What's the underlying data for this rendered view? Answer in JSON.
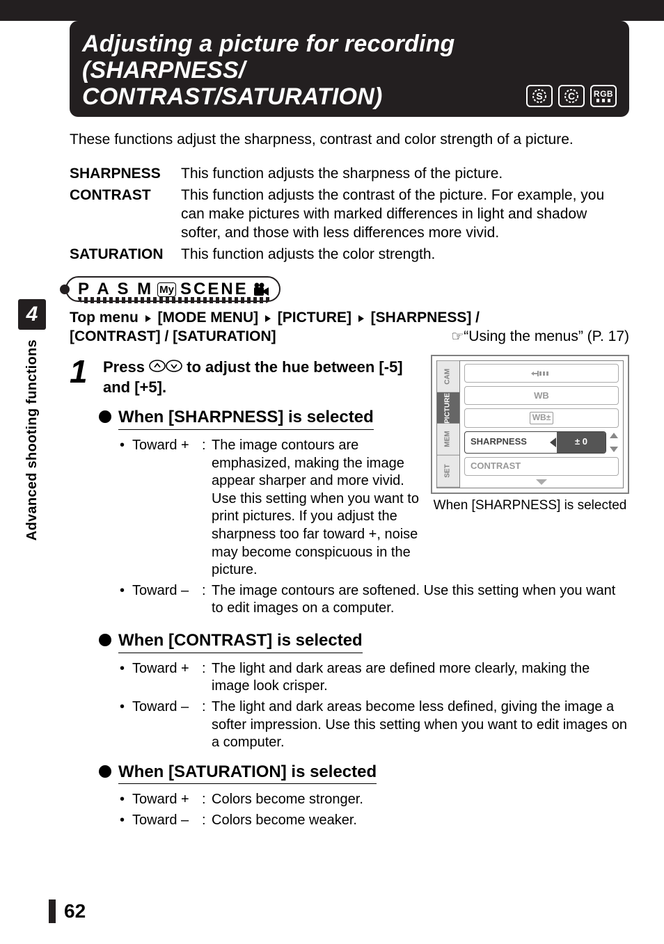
{
  "header": {
    "title_line1": "Adjusting a picture for recording (SHARPNESS/",
    "title_line2": "CONTRAST/SATURATION)",
    "icons": {
      "s": "S",
      "c": "C",
      "rgb": "RGB"
    }
  },
  "intro": "These functions adjust the sharpness, contrast and color strength of a picture.",
  "definitions": {
    "sharpness": {
      "term": "SHARPNESS",
      "desc": "This function adjusts the sharpness of the picture."
    },
    "contrast": {
      "term": "CONTRAST",
      "desc": "This function adjusts the contrast of the picture. For example, you can make pictures with marked differences in light and shadow softer, and those with less differences more vivid."
    },
    "saturation": {
      "term": "SATURATION",
      "desc": "This function adjusts the color strength."
    }
  },
  "mode_badge": {
    "modes": "P A S M",
    "my": "My",
    "scene": "SCENE"
  },
  "menu_path": {
    "line1_a": "Top menu ",
    "mode_menu": "[MODE MENU]",
    "picture": "[PICTURE]",
    "sharp": "[SHARPNESS] /",
    "line2_left": "[CONTRAST] / [SATURATION]",
    "ref_text": "“Using the menus” (P. 17)"
  },
  "step1": {
    "num": "1",
    "text_a": "Press ",
    "text_b": " to adjust the hue between [-5] and [+5]."
  },
  "screen": {
    "tabs": {
      "cam": "CAM",
      "picture": "PICTURE",
      "mem": "MEM",
      "set": "SET"
    },
    "items": {
      "wb": "WB",
      "wb_comp": "WB±",
      "sharpness": "SHARPNESS",
      "sharpness_val": "± 0",
      "contrast": "CONTRAST"
    },
    "caption": "When [SHARPNESS] is selected"
  },
  "sections": {
    "sharpness": {
      "title": "When [SHARPNESS] is selected",
      "plus_label": "Toward +",
      "plus_text": "The image contours are emphasized, making the image appear sharper and more vivid. Use this setting when you want to print pictures. If you adjust the sharpness too far toward +, noise may become conspicuous in the picture.",
      "minus_label": "Toward –",
      "minus_text": "The image contours are softened. Use this setting when you want to edit images on a computer."
    },
    "contrast": {
      "title": "When [CONTRAST] is selected",
      "plus_label": "Toward +",
      "plus_text": "The light and dark areas are defined more clearly, making the image look crisper.",
      "minus_label": "Toward –",
      "minus_text": "The light and dark areas become less defined, giving the image a softer impression. Use this setting when you want to edit images on a computer."
    },
    "saturation": {
      "title": "When [SATURATION] is selected",
      "plus_label": "Toward +",
      "plus_text": "Colors become stronger.",
      "minus_label": "Toward –",
      "minus_text": "Colors become weaker."
    }
  },
  "side": {
    "chapter_num": "4",
    "chapter_title": "Advanced shooting functions"
  },
  "footer": {
    "page": "62"
  }
}
